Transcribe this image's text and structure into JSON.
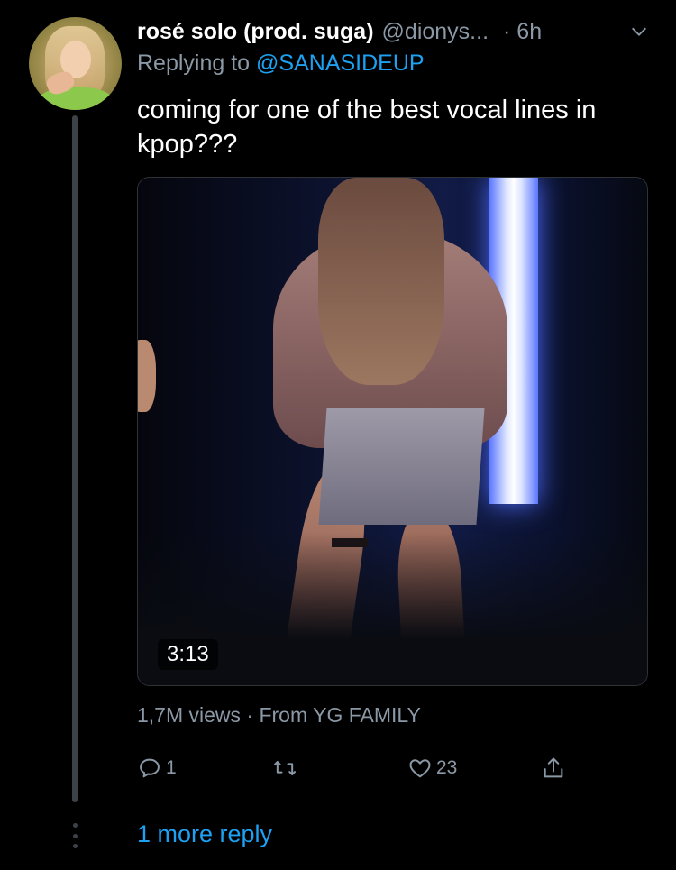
{
  "tweet": {
    "display_name": "rosé solo (prod. suga)",
    "handle": "@dionys...",
    "time": "· 6h",
    "replying_prefix": "Replying to ",
    "replying_to": "@SANASIDEUP",
    "text": "coming for one of the best vocal lines in kpop???",
    "media": {
      "duration": "3:13"
    },
    "meta": "1,7M views · From YG FAMILY",
    "actions": {
      "reply_count": "1",
      "retweet_count": "",
      "like_count": "23"
    }
  },
  "thread": {
    "more_replies": "1 more reply"
  },
  "colors": {
    "background": "#000000",
    "text_primary": "#ffffff",
    "text_secondary": "#8b98a5",
    "accent": "#1da1f2",
    "thread_line": "#3d4148"
  },
  "icons": {
    "reply": "reply-icon",
    "retweet": "retweet-icon",
    "like": "heart-icon",
    "share": "share-icon",
    "more": "chevron-down-icon"
  }
}
